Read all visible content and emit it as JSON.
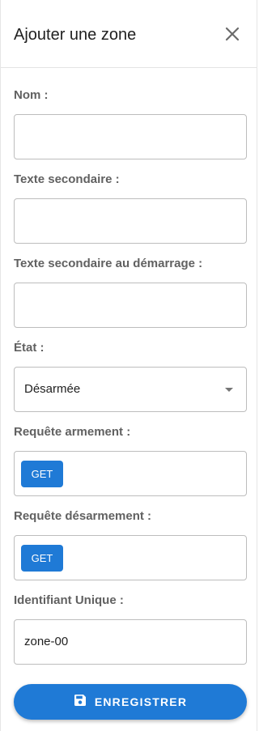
{
  "header": {
    "title": "Ajouter une zone"
  },
  "icons": {
    "close": "close-icon",
    "save": "floppy-disk-icon",
    "dropdown": "chevron-down-icon"
  },
  "colors": {
    "accent": "#1f7ad6"
  },
  "form": {
    "name": {
      "label": "Nom :",
      "value": ""
    },
    "secondary_text": {
      "label": "Texte secondaire :",
      "value": ""
    },
    "secondary_text_startup": {
      "label": "Texte secondaire au démarrage :",
      "value": ""
    },
    "state": {
      "label": "État :",
      "selected": "Désarmée"
    },
    "arm_request": {
      "label": "Requête armement :",
      "method": "GET"
    },
    "disarm_request": {
      "label": "Requête désarmement :",
      "method": "GET"
    },
    "unique_id": {
      "label": "Identifiant Unique :",
      "value": "zone-00"
    }
  },
  "actions": {
    "save_label": "ENREGISTRER"
  }
}
